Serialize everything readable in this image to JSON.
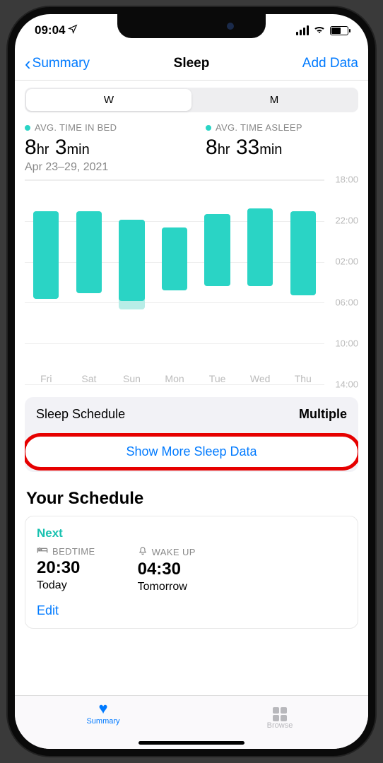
{
  "status": {
    "time": "09:04"
  },
  "nav": {
    "back": "Summary",
    "title": "Sleep",
    "add": "Add Data"
  },
  "segmented": {
    "w": "W",
    "m": "M"
  },
  "stats": {
    "inbed_label": "AVG. TIME IN BED",
    "inbed_hr_n": "8",
    "inbed_hr_u": "hr",
    "inbed_min_n": "3",
    "inbed_min_u": "min",
    "asleep_label": "AVG. TIME ASLEEP",
    "asleep_hr_n": "8",
    "asleep_hr_u": "hr",
    "asleep_min_n": "33",
    "asleep_min_u": "min",
    "range": "Apr 23–29, 2021"
  },
  "chart_data": {
    "type": "bar",
    "title": "Sleep",
    "yaxis": [
      "18:00",
      "22:00",
      "02:00",
      "06:00",
      "10:00",
      "14:00"
    ],
    "ylim_hours": [
      18,
      38
    ],
    "categories": [
      "Fri",
      "Sat",
      "Sun",
      "Mon",
      "Tue",
      "Wed",
      "Thu"
    ],
    "series": [
      {
        "name": "Time In Bed",
        "color": "#b8ede7",
        "ranges_hours": [
          [
            21.3,
            30.6
          ],
          [
            21.3,
            30.0
          ],
          [
            22.2,
            31.7
          ],
          [
            23.0,
            29.7
          ],
          [
            21.6,
            29.2
          ],
          [
            21.0,
            29.2
          ],
          [
            21.3,
            30.2
          ]
        ]
      },
      {
        "name": "Time Asleep",
        "color": "#2ad4c5",
        "ranges_hours": [
          [
            21.3,
            30.6
          ],
          [
            21.3,
            30.0
          ],
          [
            22.2,
            30.8
          ],
          [
            23.0,
            29.7
          ],
          [
            21.6,
            29.2
          ],
          [
            21.0,
            29.2
          ],
          [
            21.3,
            30.2
          ]
        ]
      }
    ]
  },
  "sleep_schedule": {
    "title": "Sleep Schedule",
    "value": "Multiple"
  },
  "show_more": "Show More Sleep Data",
  "your_schedule": {
    "heading": "Your Schedule",
    "next": "Next",
    "bedtime_label": "BEDTIME",
    "bedtime_val": "20:30",
    "bedtime_sub": "Today",
    "wake_label": "WAKE UP",
    "wake_val": "04:30",
    "wake_sub": "Tomorrow",
    "edit": "Edit"
  },
  "tabs": {
    "summary": "Summary",
    "browse": "Browse"
  }
}
